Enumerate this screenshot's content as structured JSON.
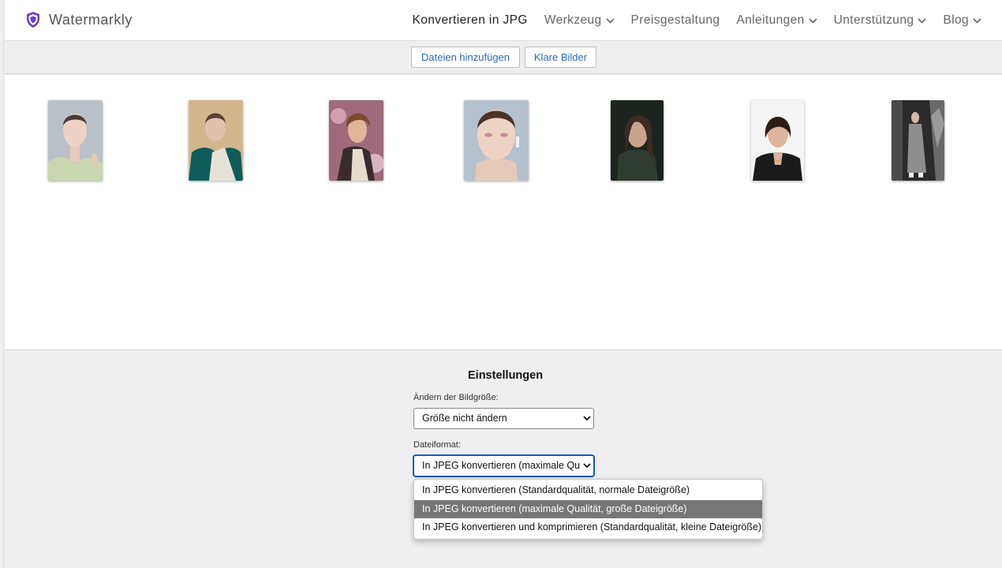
{
  "brand": {
    "name": "Watermarkly",
    "accent": "#6a3fd0"
  },
  "nav": [
    {
      "label": "Konvertieren in JPG",
      "dropdown": false,
      "active": true
    },
    {
      "label": "Werkzeug",
      "dropdown": true,
      "active": false
    },
    {
      "label": "Preisgestaltung",
      "dropdown": false,
      "active": false
    },
    {
      "label": "Anleitungen",
      "dropdown": true,
      "active": false
    },
    {
      "label": "Unterstützung",
      "dropdown": true,
      "active": false
    },
    {
      "label": "Blog",
      "dropdown": true,
      "active": false
    }
  ],
  "toolbar": {
    "add_files": "Dateien hinzufügen",
    "clear_images": "Klare Bilder"
  },
  "gallery": {
    "image_count": 7
  },
  "settings": {
    "title": "Einstellungen",
    "resize_label": "Ändern der Bildgröße:",
    "resize_value": "Größe nicht ändern",
    "format_label": "Dateiformat:",
    "format_value": "In JPEG konvertieren (maximale Qua",
    "format_options": [
      "In JPEG konvertieren (Standardqualität, normale Dateigröße)",
      "In JPEG konvertieren (maximale Qualität, große Dateigröße)",
      "In JPEG konvertieren und komprimieren (Standardqualität, kleine Dateigröße)"
    ],
    "format_selected_index": 1
  }
}
